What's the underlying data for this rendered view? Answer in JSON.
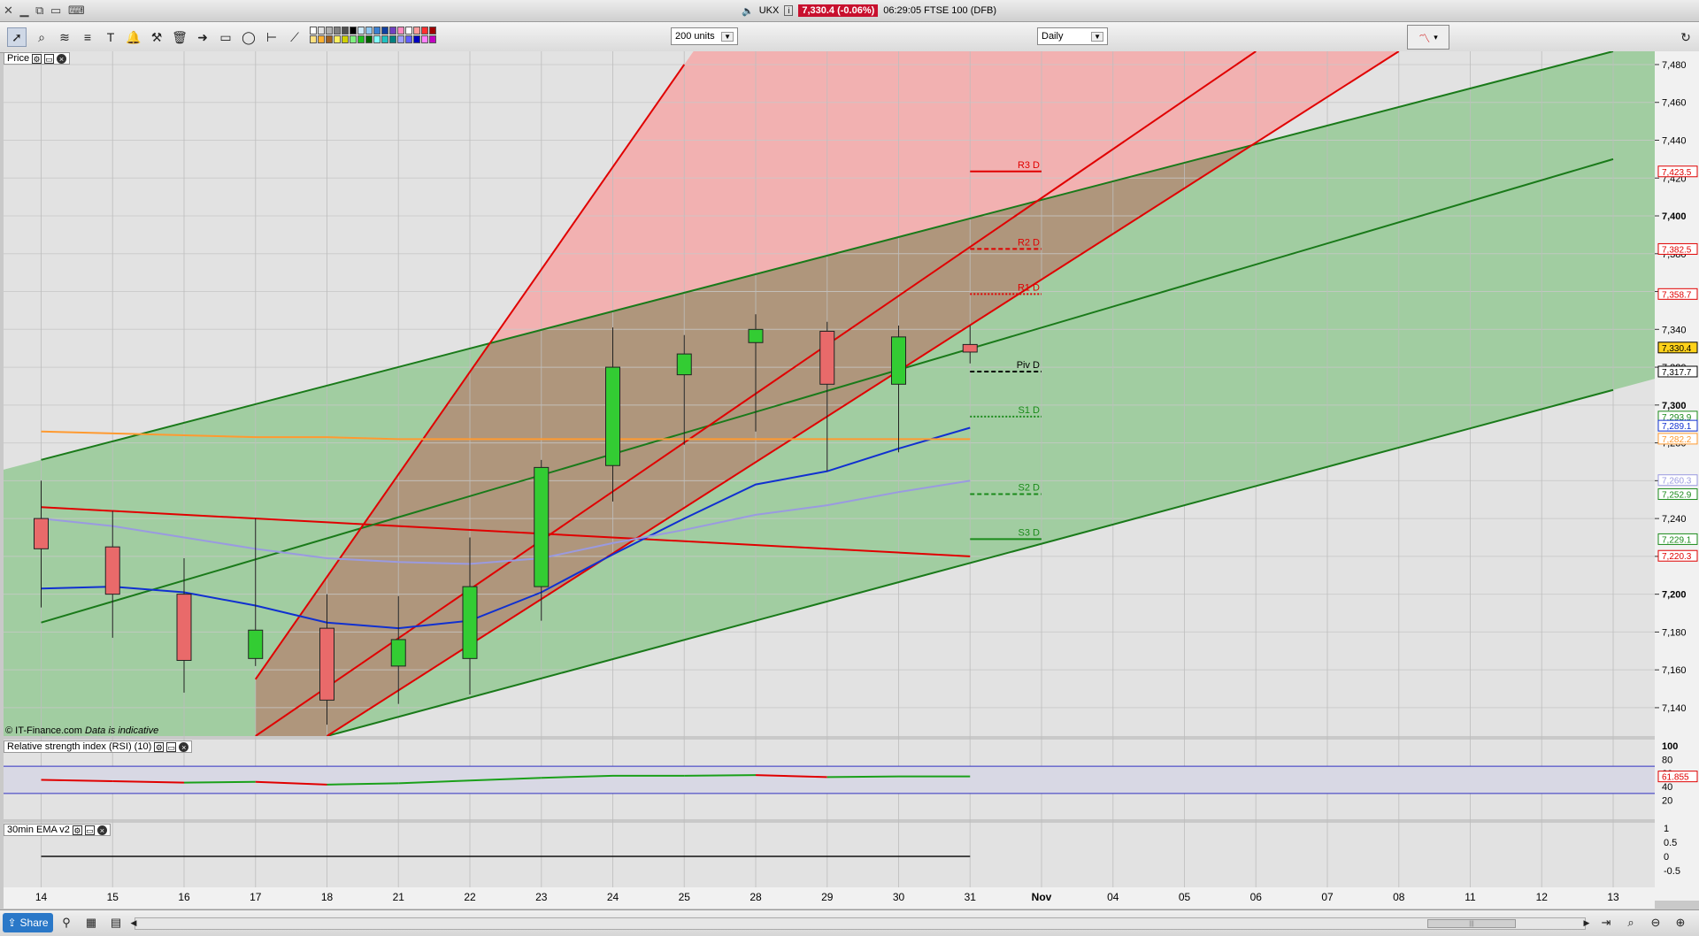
{
  "window": {
    "title_symbol": "UKX",
    "price_chip": "7,330.4 (-0.06%)",
    "timestamp_label": "06:29:05 FTSE 100 (DFB)"
  },
  "toolbar": {
    "units_select": "200 units",
    "interval_select": "Daily",
    "swatch_colors": [
      "#ffffff",
      "#e0e0e0",
      "#b0b0b0",
      "#808080",
      "#505050",
      "#000000",
      "#cde8f8",
      "#8fc8f0",
      "#3a7fd0",
      "#1040a0",
      "#7040c0",
      "#ff8ac0",
      "#ffffff",
      "#ff9a9a",
      "#ff3030",
      "#a00000",
      "#ffe080",
      "#ffb030",
      "#a06020",
      "#fff060",
      "#d0d000",
      "#80f080",
      "#20c020",
      "#006000",
      "#80ffff",
      "#20c0c0",
      "#008080",
      "#a0a0ff",
      "#6060ff",
      "#0000c0",
      "#ff80ff",
      "#c000c0"
    ]
  },
  "panels": {
    "price": {
      "label": "Price"
    },
    "rsi": {
      "label": "Relative strength index (RSI) (10)",
      "value_chip": "61.855",
      "axis_ticks": [
        "100",
        "80",
        "60",
        "40",
        "20"
      ]
    },
    "ema": {
      "label": "30min EMA v2",
      "axis_ticks": [
        "1",
        "0.5",
        "0",
        "-0.5"
      ]
    }
  },
  "watermark": {
    "brand": "© IT-Finance.com",
    "note": "Data is indicative"
  },
  "colors": {
    "up": "#33cc33",
    "down": "#e96a6a",
    "red_line": "#e00000",
    "green_line": "#1a7a1a",
    "blue_ma": "#1030d0",
    "lavender_ma": "#9a9ae0",
    "orange_ma": "#ff9a30",
    "green_fill": "#9acb9a",
    "brown_fill": "#a89478",
    "pink_fill": "#f4a8a8"
  },
  "bottombar": {
    "share_label": "Share"
  },
  "chart_data": {
    "type": "candlestick",
    "x_labels": [
      "14",
      "15",
      "16",
      "17",
      "18",
      "21",
      "22",
      "23",
      "24",
      "25",
      "28",
      "29",
      "30",
      "31",
      "Nov",
      "04",
      "05",
      "06",
      "07",
      "08",
      "11",
      "12",
      "13"
    ],
    "ylim": [
      7125,
      7487
    ],
    "y_ticks": [
      7140,
      7160,
      7180,
      7200,
      7220,
      7240,
      7260,
      7280,
      7300,
      7320,
      7340,
      7360,
      7380,
      7400,
      7420,
      7440,
      7460,
      7480
    ],
    "y_tick_labels": [
      "7,140",
      "7,160",
      "7,180",
      "7,200",
      "7,220",
      "7,240",
      "7,260",
      "7,280",
      "7,300",
      "7,320",
      "7,340",
      "7,360",
      "7,380",
      "7,400",
      "7,420",
      "7,440",
      "7,460",
      "7,480"
    ],
    "candles": [
      {
        "date": "14",
        "open": 7240,
        "high": 7260,
        "low": 7193,
        "close": 7224
      },
      {
        "date": "15",
        "open": 7225,
        "high": 7244,
        "low": 7177,
        "close": 7200
      },
      {
        "date": "16",
        "open": 7200,
        "high": 7219,
        "low": 7148,
        "close": 7165
      },
      {
        "date": "17",
        "open": 7166,
        "high": 7240,
        "low": 7162,
        "close": 7181
      },
      {
        "date": "18",
        "open": 7182,
        "high": 7200,
        "low": 7131,
        "close": 7144
      },
      {
        "date": "21",
        "open": 7162,
        "high": 7199,
        "low": 7142,
        "close": 7176
      },
      {
        "date": "22",
        "open": 7166,
        "high": 7230,
        "low": 7147,
        "close": 7204
      },
      {
        "date": "23",
        "open": 7204,
        "high": 7271,
        "low": 7186,
        "close": 7267
      },
      {
        "date": "24",
        "open": 7268,
        "high": 7341,
        "low": 7249,
        "close": 7320
      },
      {
        "date": "25",
        "open": 7316,
        "high": 7337,
        "low": 7279,
        "close": 7327
      },
      {
        "date": "28",
        "open": 7333,
        "high": 7348,
        "low": 7286,
        "close": 7340
      },
      {
        "date": "29",
        "open": 7339,
        "high": 7344,
        "low": 7265,
        "close": 7311
      },
      {
        "date": "30",
        "open": 7311,
        "high": 7342,
        "low": 7275,
        "close": 7336
      },
      {
        "date": "31",
        "open": 7332,
        "high": 7342,
        "low": 7322,
        "close": 7328
      }
    ],
    "moving_averages": [
      {
        "color": "blue",
        "values": [
          7203,
          7204,
          7201,
          7194,
          7185,
          7182,
          7186,
          7201,
          7221,
          7240,
          7258,
          7265,
          7277,
          7288
        ]
      },
      {
        "color": "lavender",
        "values": [
          7240,
          7236,
          7230,
          7224,
          7219,
          7217,
          7216,
          7219,
          7227,
          7234,
          7242,
          7247,
          7254,
          7260
        ]
      },
      {
        "color": "orange",
        "values": [
          7286,
          7285,
          7284,
          7283,
          7283,
          7282,
          7282,
          7282,
          7282,
          7282,
          7282,
          7282,
          7282,
          7282
        ]
      }
    ],
    "trend_lines": [
      {
        "color": "red",
        "from": {
          "x": "14",
          "y": 7246
        },
        "to": {
          "x": "31",
          "y": 7220
        }
      },
      {
        "color": "green",
        "from": {
          "x": "14",
          "y": 7271
        },
        "to": {
          "x": "13",
          "y": 7487
        }
      },
      {
        "color": "green",
        "from": {
          "x": "14",
          "y": 7185
        },
        "to": {
          "x": "13",
          "y": 7430
        }
      },
      {
        "color": "green",
        "from": {
          "x": "18",
          "y": 7125
        },
        "to": {
          "x": "13",
          "y": 7308
        }
      },
      {
        "color": "red",
        "from": {
          "x": "17",
          "y": 7155
        },
        "to": {
          "x": "25",
          "y": 7480
        }
      },
      {
        "color": "red",
        "from": {
          "x": "17",
          "y": 7125
        },
        "to": {
          "x": "06",
          "y": 7487
        }
      },
      {
        "color": "red",
        "from": {
          "x": "18",
          "y": 7125
        },
        "to": {
          "x": "08",
          "y": 7487
        }
      }
    ],
    "pivots": [
      {
        "label": "R3 D",
        "value": 7423.5,
        "color": "#e00000",
        "style": "solid"
      },
      {
        "label": "R2 D",
        "value": 7382.5,
        "color": "#e00000",
        "style": "dashed"
      },
      {
        "label": "R1 D",
        "value": 7358.7,
        "color": "#e00000",
        "style": "dotted"
      },
      {
        "label": "Piv D",
        "value": 7317.7,
        "color": "#000000",
        "style": "dashed"
      },
      {
        "label": "S1 D",
        "value": 7293.9,
        "color": "#1a8a1a",
        "style": "dotted"
      },
      {
        "label": "S2 D",
        "value": 7252.9,
        "color": "#1a8a1a",
        "style": "dashed"
      },
      {
        "label": "S3 D",
        "value": 7229.1,
        "color": "#1a8a1a",
        "style": "solid"
      }
    ],
    "price_markers": [
      {
        "value": 7423.5,
        "text": "7,423.5",
        "color": "#e00000",
        "bg": "#fff"
      },
      {
        "value": 7382.5,
        "text": "7,382.5",
        "color": "#e00000",
        "bg": "#fff"
      },
      {
        "value": 7358.7,
        "text": "7,358.7",
        "color": "#e00000",
        "bg": "#fff"
      },
      {
        "value": 7330.4,
        "text": "7,330.4",
        "color": "#000000",
        "bg": "#ffd21a"
      },
      {
        "value": 7317.7,
        "text": "7,317.7",
        "color": "#000000",
        "bg": "#fff"
      },
      {
        "value": 7293.9,
        "text": "7,293.9",
        "color": "#1a8a1a",
        "bg": "#fff"
      },
      {
        "value": 7289.1,
        "text": "7,289.1",
        "color": "#1030d0",
        "bg": "#fff"
      },
      {
        "value": 7282.2,
        "text": "7,282.2",
        "color": "#ff9a30",
        "bg": "#fff"
      },
      {
        "value": 7260.3,
        "text": "7,260.3",
        "color": "#9a9ae0",
        "bg": "#fff"
      },
      {
        "value": 7252.9,
        "text": "7,252.9",
        "color": "#1a8a1a",
        "bg": "#fff"
      },
      {
        "value": 7229.1,
        "text": "7,229.1",
        "color": "#1a8a1a",
        "bg": "#fff"
      },
      {
        "value": 7220.3,
        "text": "7,220.3",
        "color": "#e00000",
        "bg": "#fff"
      }
    ],
    "rsi": {
      "ylim": [
        0,
        100
      ],
      "levels": [
        70,
        30
      ],
      "values": [
        50,
        48,
        46,
        47,
        43,
        45,
        49,
        53,
        56,
        56,
        57,
        54,
        55,
        55
      ]
    },
    "ema_panel": {
      "ylim": [
        -1,
        1
      ],
      "values": [
        0,
        0,
        0,
        0,
        0,
        0,
        0,
        0,
        0,
        0,
        0,
        0,
        0,
        0
      ]
    }
  }
}
